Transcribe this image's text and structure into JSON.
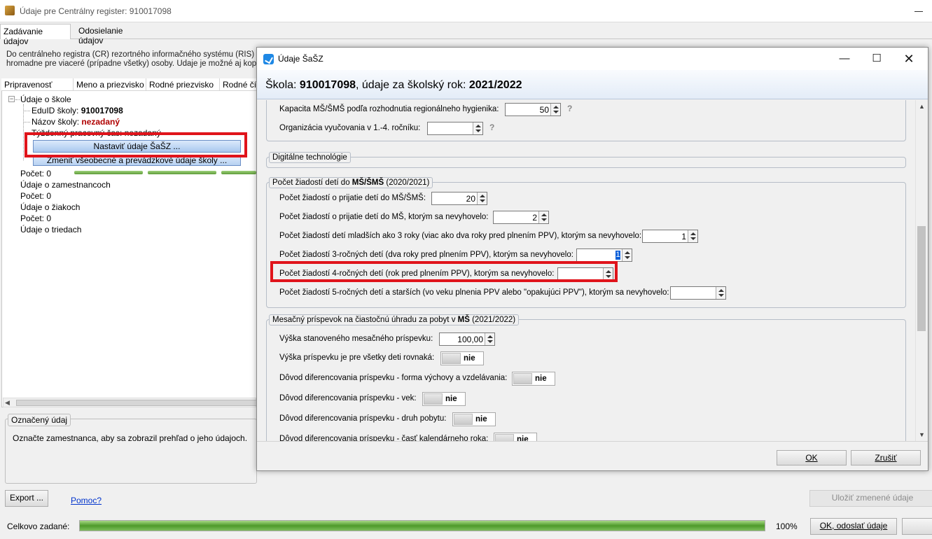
{
  "main": {
    "window_title": "Údaje pre Centrálny register: 910017098",
    "tabs": [
      "Zadávanie údajov",
      "Odosielanie údajov"
    ],
    "info_line1": "Do centrálneho registra (CR) rezortného informačného systému (RIS) sa d",
    "info_line2": "hromadne pre viaceré (prípadne všetky) osoby. Údaje je možné aj kopírov",
    "grid_headers": [
      "Pripravenosť",
      "Meno a priezvisko",
      "Rodné priezvisko",
      "Rodné čís"
    ],
    "tree": {
      "root": "Údaje o škole",
      "eduid_label": "EduID školy:",
      "eduid_value": "910017098",
      "nazov_label": "Názov školy:",
      "nazov_value": "nezadaný",
      "tyzdenny": "Týždenný pracovný čas: nezadaný",
      "btn_nastavit": "Nastaviť údaje ŠaŠZ ...",
      "btn_zmenit": "Zmeniť všeobecné a prevádzkové údaje školy ...",
      "pocet1": "Počet: 0",
      "zamestnanci": "Údaje o zamestnancoch",
      "pocet2": "Počet: 0",
      "ziaci": "Údaje o žiakoch",
      "pocet3": "Počet: 0",
      "triedy": "Údaje o triedach"
    },
    "oznaceny_legend": "Označený údaj",
    "oznaceny_text": "Označte zamestnanca, aby sa zobrazil prehľad o jeho údajoch.",
    "export_label": "Export ...",
    "pomoc_label": "Pomoc?",
    "ulozit_label": "Uložiť zmenené údaje",
    "status_label": "Celkovo zadané:",
    "total_progress": 100,
    "total_pct": "100%",
    "ok_odoslat_label": "OK, odoslať údaje"
  },
  "dialog": {
    "title": "Údaje ŠaŠZ",
    "header_prefix": "Škola: ",
    "header_code": "910017098",
    "header_mid": ", údaje za školský rok: ",
    "header_year": "2021/2022",
    "kapacita_label": "Kapacita MŠ/ŠMŠ podľa rozhodnutia regionálneho hygienika:",
    "kapacita_value": "50",
    "organizacia_label": "Organizácia vyučovania v 1.-4. ročníku:",
    "organizacia_value": "",
    "qmark": "?",
    "digital_legend": "Digitálne technológie",
    "pocet_legend_prefix": "Počet žiadostí detí do ",
    "pocet_legend_bold": "MŠ/ŠMŠ",
    "pocet_legend_suffix": " (2020/2021)",
    "rows": [
      {
        "label": "Počet žiadostí o prijatie detí do MŠ/ŠMŠ:",
        "value": "20"
      },
      {
        "label": "Počet žiadostí o prijatie detí do MŠ, ktorým sa nevyhovelo:",
        "value": "2"
      },
      {
        "label": "Počet žiadostí detí mladších ako 3 roky (viac ako dva roky pred plnením PPV), ktorým sa nevyhovelo:",
        "value": "1"
      },
      {
        "label": "Počet žiadostí 3-ročných detí (dva roky pred plnením PPV), ktorým sa nevyhovelo:",
        "value": "1"
      },
      {
        "label": "Počet žiadostí 4-ročných detí (rok pred plnením PPV), ktorým sa nevyhovelo:",
        "value": ""
      },
      {
        "label": "Počet žiadostí 5-ročných detí a starších (vo veku plnenia PPV alebo \"opakujúci PPV\"), ktorým sa nevyhovelo:",
        "value": ""
      }
    ],
    "prispevok_legend_prefix": "Mesačný príspevok na čiastočnú úhradu za pobyt v ",
    "prispevok_legend_bold": "MŠ",
    "prispevok_legend_suffix": " (2021/2022)",
    "vyska_label": "Výška stanoveného mesačného príspevku:",
    "vyska_value": "100,00",
    "toggles": [
      {
        "label": "Výška príspevku je pre všetky deti rovnaká:",
        "value": "nie"
      },
      {
        "label": "Dôvod diferencovania príspevku - forma výchovy a vzdelávania:",
        "value": "nie"
      },
      {
        "label": "Dôvod diferencovania príspevku - vek:",
        "value": "nie"
      },
      {
        "label": "Dôvod diferencovania príspevku - druh pobytu:",
        "value": "nie"
      },
      {
        "label": "Dôvod diferencovania príspevku - časť kalendárneho roka:",
        "value": "nie"
      }
    ],
    "ok_label": "OK",
    "cancel_label": "Zrušiť"
  }
}
